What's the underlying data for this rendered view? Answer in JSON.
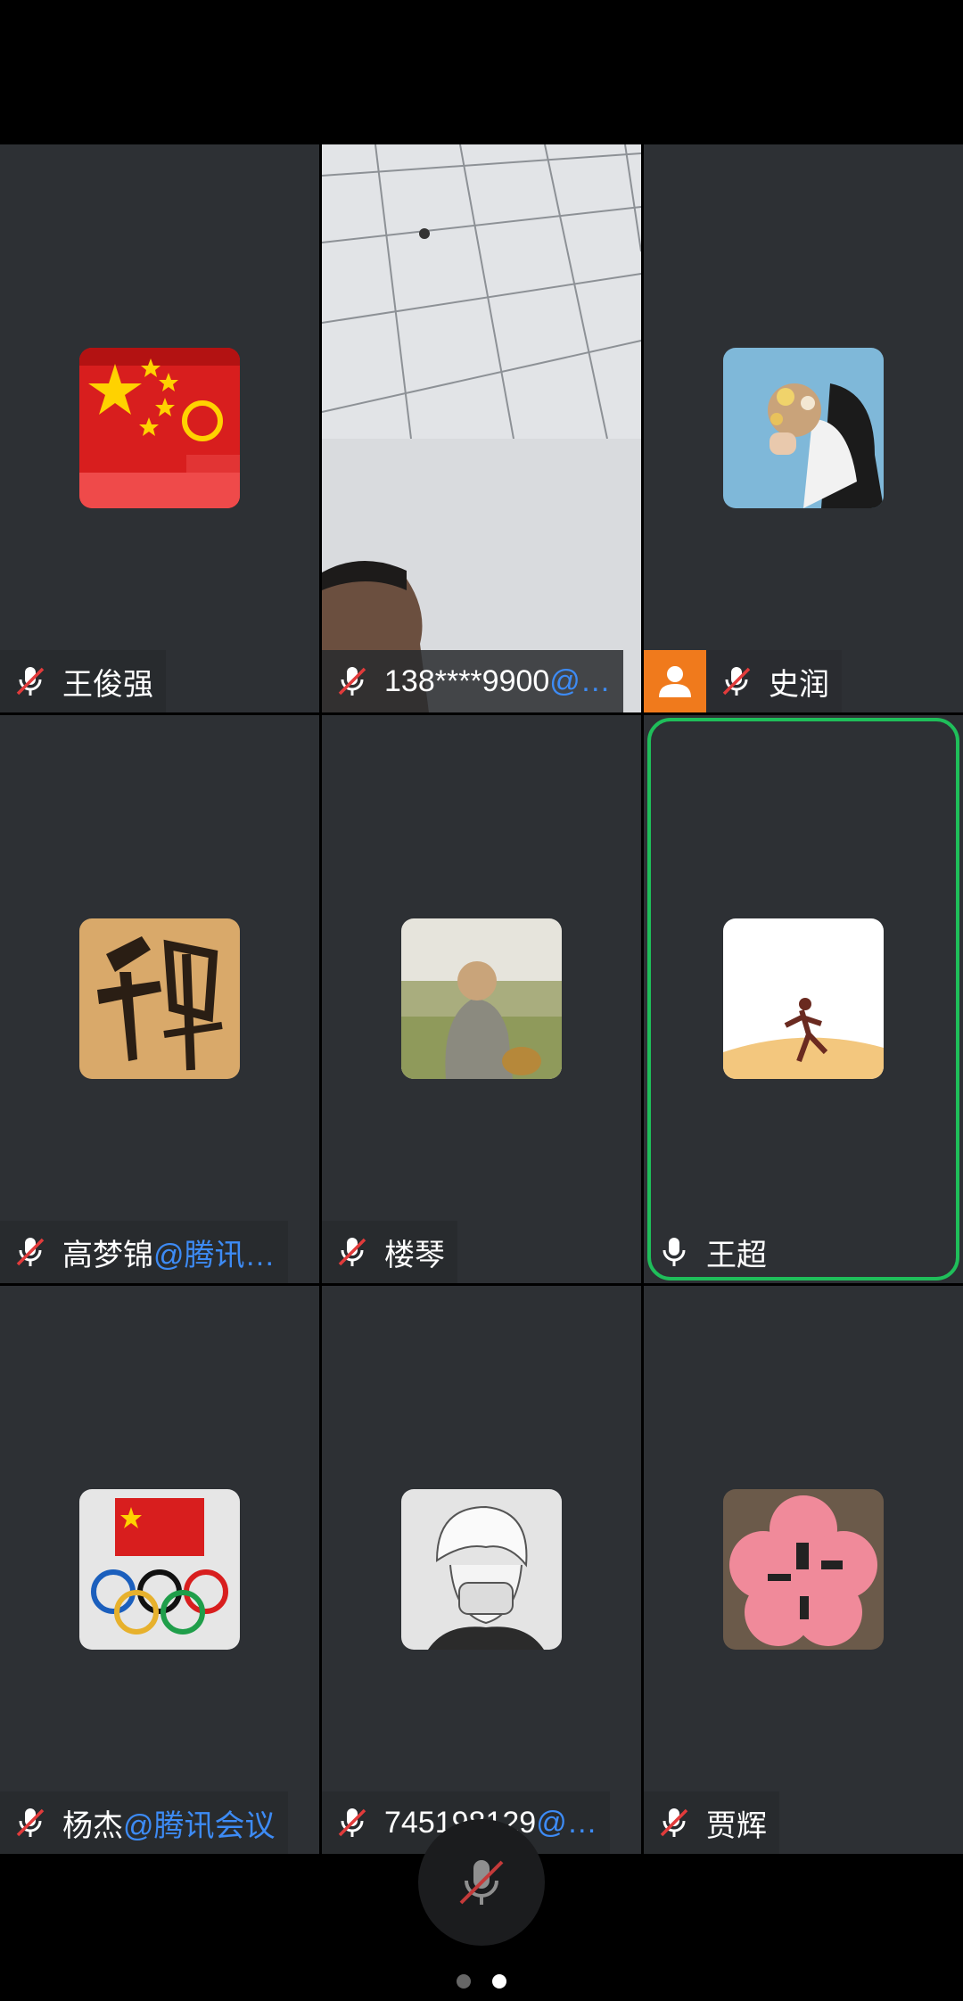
{
  "participants": [
    {
      "name": "王俊强",
      "org": "",
      "mic": "muted"
    },
    {
      "name": "138****9900",
      "org": "@…",
      "mic": "muted"
    },
    {
      "name": "史润",
      "org": "",
      "mic": "muted",
      "host": true
    },
    {
      "name": "高梦锦",
      "org": "@腾讯…",
      "mic": "muted"
    },
    {
      "name": "楼琴",
      "org": "",
      "mic": "muted"
    },
    {
      "name": "王超",
      "org": "",
      "mic": "on",
      "speaking": true
    },
    {
      "name": "杨杰",
      "org": "@腾讯会议",
      "mic": "muted"
    },
    {
      "name": "745198129",
      "org": "@…",
      "mic": "muted"
    },
    {
      "name": "贾辉",
      "org": "",
      "mic": "muted"
    }
  ],
  "avatars": {
    "p1": "red-party-card-avatar",
    "p3": "flowers-portrait-avatar",
    "p4": "calligraphy-avatar",
    "p5": "person-with-dog-avatar",
    "p6": "runner-silhouette-avatar",
    "p7": "flag-olympic-rings-avatar",
    "p8": "anime-sketch-avatar",
    "p9": "pink-flower-avatar"
  },
  "controls": {
    "mute_button": "mic-muted-icon"
  },
  "pager": {
    "pages": 2,
    "current": 2
  },
  "colors": {
    "speaking_border": "#1fbe5a",
    "org_link": "#3d8bf5",
    "host_badge": "#f07a1c"
  }
}
